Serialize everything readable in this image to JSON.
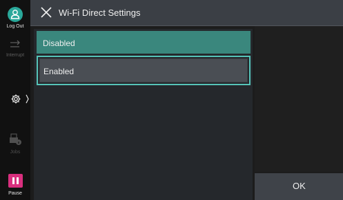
{
  "rail": {
    "logout_label": "Log Out",
    "interrupt_label": "Interrupt",
    "jobs_label": "Jobs",
    "pause_label": "Pause",
    "icons": [
      "user-icon",
      "interrupt-icon",
      "gear-icon",
      "chevron-right-icon",
      "printer-info-icon",
      "pause-icon"
    ],
    "accent_color": "#2aa89a",
    "pause_color": "#d92f7e"
  },
  "header": {
    "title": "Wi-Fi Direct Settings",
    "close_icon": "close-icon"
  },
  "options": {
    "items": [
      {
        "label": "Disabled",
        "selected": true
      },
      {
        "label": "Enabled",
        "selected": false,
        "focused": true
      }
    ],
    "selected_color": "#3a877d",
    "focus_color": "#56c4b9"
  },
  "actions": {
    "ok_label": "OK"
  }
}
